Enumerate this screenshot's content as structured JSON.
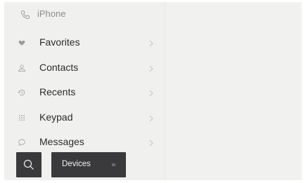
{
  "header": {
    "title": "iPhone",
    "icon": "phone-icon"
  },
  "menu": {
    "items": [
      {
        "label": "Favorites",
        "icon": "heart-icon"
      },
      {
        "label": "Contacts",
        "icon": "person-icon"
      },
      {
        "label": "Recents",
        "icon": "history-icon"
      },
      {
        "label": "Keypad",
        "icon": "keypad-icon"
      },
      {
        "label": "Messages",
        "icon": "message-icon"
      }
    ]
  },
  "toolbar": {
    "search_icon": "search-icon",
    "devices_label": "Devices"
  },
  "colors": {
    "panel_background": "#f0f0ef",
    "button_background": "#3a3a3c",
    "text_primary": "#2b2b2b",
    "text_muted": "#8e8e8e"
  }
}
